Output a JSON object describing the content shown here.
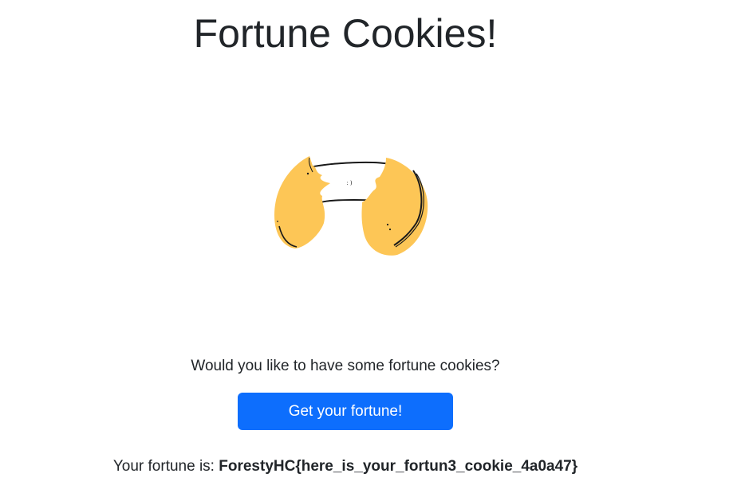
{
  "header": {
    "title": "Fortune Cookies!"
  },
  "illustration": {
    "icon": "fortune-cookie-icon",
    "paper_text": ": )",
    "colors": {
      "cookie": "#fdc656",
      "outline": "#1a1a1a",
      "paper": "#ffffff"
    }
  },
  "main": {
    "question": "Would you like to have some fortune cookies?",
    "button_label": "Get your fortune!",
    "result_label": "Your fortune is:",
    "result_value": "ForestyHC{here_is_your_fortun3_cookie_4a0a47}"
  },
  "colors": {
    "primary_button": "#0d6efd",
    "text": "#212529",
    "background": "#ffffff"
  }
}
